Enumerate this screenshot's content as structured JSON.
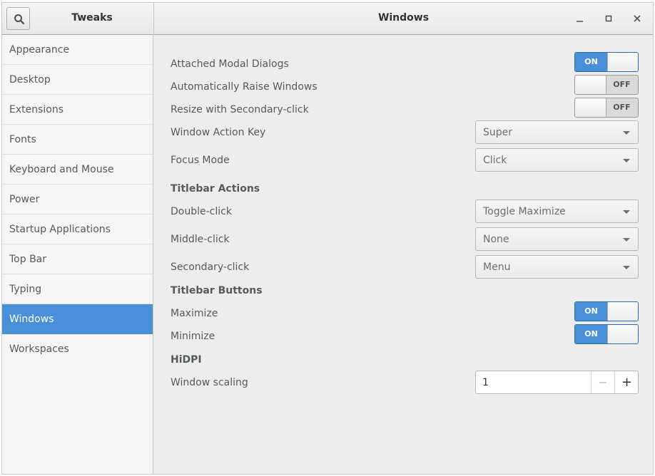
{
  "sidebar_title": "Tweaks",
  "main_title": "Windows",
  "sidebar": {
    "items": [
      {
        "label": "Appearance"
      },
      {
        "label": "Desktop"
      },
      {
        "label": "Extensions"
      },
      {
        "label": "Fonts"
      },
      {
        "label": "Keyboard and Mouse"
      },
      {
        "label": "Power"
      },
      {
        "label": "Startup Applications"
      },
      {
        "label": "Top Bar"
      },
      {
        "label": "Typing"
      },
      {
        "label": "Windows"
      },
      {
        "label": "Workspaces"
      }
    ],
    "selected": "Windows"
  },
  "settings": {
    "attached_modal": {
      "label": "Attached Modal Dialogs",
      "state": "ON"
    },
    "auto_raise": {
      "label": "Automatically Raise Windows",
      "state": "OFF"
    },
    "resize_secondary": {
      "label": "Resize with Secondary-click",
      "state": "OFF"
    },
    "action_key": {
      "label": "Window Action Key",
      "value": "Super"
    },
    "focus_mode": {
      "label": "Focus Mode",
      "value": "Click"
    },
    "titlebar_actions_heading": "Titlebar Actions",
    "double_click": {
      "label": "Double-click",
      "value": "Toggle Maximize"
    },
    "middle_click": {
      "label": "Middle-click",
      "value": "None"
    },
    "secondary_click": {
      "label": "Secondary-click",
      "value": "Menu"
    },
    "titlebar_buttons_heading": "Titlebar Buttons",
    "maximize": {
      "label": "Maximize",
      "state": "ON"
    },
    "minimize": {
      "label": "Minimize",
      "state": "ON"
    },
    "hidpi_heading": "HiDPI",
    "window_scaling": {
      "label": "Window scaling",
      "value": "1",
      "minus": "−",
      "plus": "+"
    }
  },
  "switch_text": {
    "on": "ON",
    "off": "OFF"
  },
  "colors": {
    "accent": "#4a90d9",
    "background": "#ededed",
    "sidebar": "#f6f6f6"
  }
}
